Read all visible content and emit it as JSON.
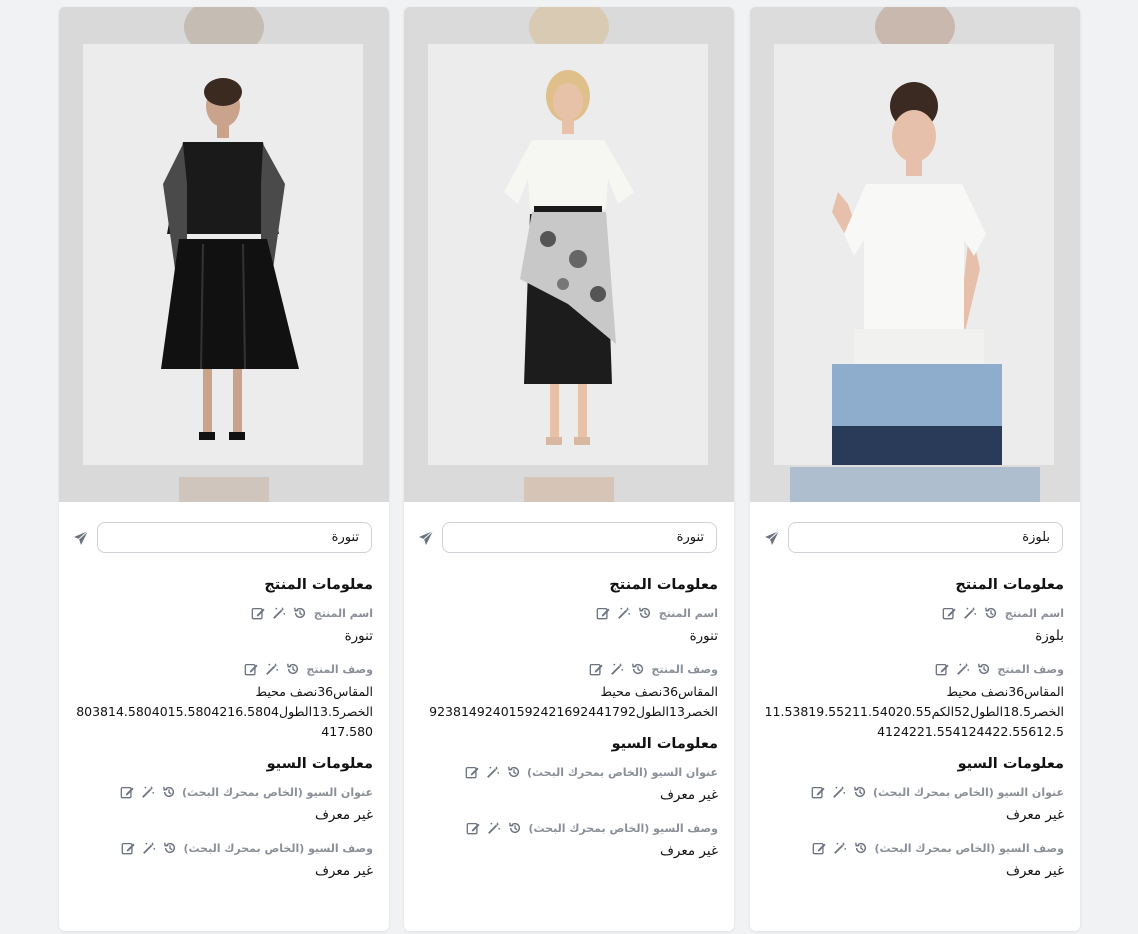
{
  "products": [
    {
      "input_value": "تنورة",
      "product_section_title": "معلومات المنتج",
      "name_label": "اسم المنتج",
      "name_value": "تنورة",
      "desc_label": "وصف المنتج",
      "desc_lines": [
        "المقاس36نصف محيط",
        "الخصر13.5الطول803814.5804015.5804216.5804",
        "417.580"
      ],
      "seo_section_title": "معلومات السيو",
      "seo_title_label": "عنوان السيو (الخاص بمحرك البحث)",
      "seo_title_value": "غير معرف",
      "seo_desc_label": "وصف السيو (الخاص بمحرك البحث)",
      "seo_desc_value": "غير معرف"
    },
    {
      "input_value": "تنورة",
      "product_section_title": "معلومات المنتج",
      "name_label": "اسم المنتج",
      "name_value": "تنورة",
      "desc_label": "وصف المنتج",
      "desc_lines": [
        "المقاس36نصف محيط",
        "الخصر13الطول92381492401592421692441792"
      ],
      "seo_section_title": "معلومات السيو",
      "seo_title_label": "عنوان السيو (الخاص بمحرك البحث)",
      "seo_title_value": "غير معرف",
      "seo_desc_label": "وصف السيو (الخاص بمحرك البحث)",
      "seo_desc_value": "غير معرف"
    },
    {
      "input_value": "بلوزة",
      "product_section_title": "معلومات المنتج",
      "name_label": "اسم المنتج",
      "name_value": "بلوزة",
      "desc_label": "وصف المنتج",
      "desc_lines": [
        "المقاس36نصف محيط",
        "الخصر18.5الطول52الكم11.53819.55211.54020.55",
        "4124221.554124422.55612.5"
      ],
      "seo_section_title": "معلومات السيو",
      "seo_title_label": "عنوان السيو (الخاص بمحرك البحث)",
      "seo_title_value": "غير معرف",
      "seo_desc_label": "وصف السيو (الخاص بمحرك البحث)",
      "seo_desc_value": "غير معرف"
    }
  ],
  "icons": {
    "send": "send-icon",
    "edit": "edit-icon",
    "magic": "magic-wand-icon",
    "history": "history-icon"
  },
  "colors": {
    "page_bg": "#f1f2f4",
    "card_bg": "#ffffff",
    "label_gray": "#8a8f98",
    "icon_gray": "#6b7280"
  }
}
